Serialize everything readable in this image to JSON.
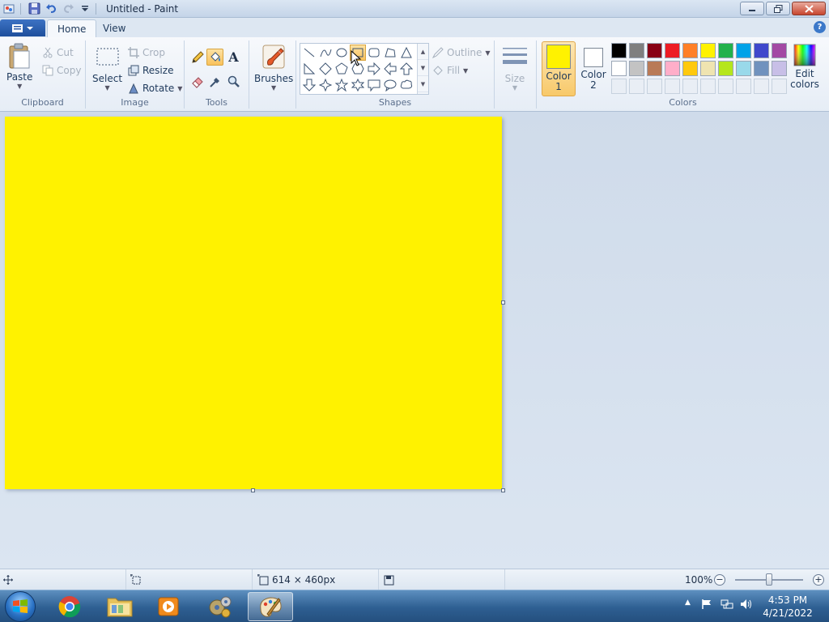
{
  "window": {
    "title": "Untitled - Paint"
  },
  "tabs": [
    {
      "label": "Home",
      "active": true
    },
    {
      "label": "View",
      "active": false
    }
  ],
  "ribbon": {
    "clipboard": {
      "label": "Clipboard",
      "paste": "Paste",
      "cut": "Cut",
      "copy": "Copy"
    },
    "image": {
      "label": "Image",
      "select": "Select",
      "crop": "Crop",
      "resize": "Resize",
      "rotate": "Rotate"
    },
    "tools": {
      "label": "Tools"
    },
    "brushes": {
      "label": "Brushes"
    },
    "shapes": {
      "label": "Shapes",
      "outline": "Outline",
      "fill": "Fill"
    },
    "size": {
      "label": "Size"
    },
    "colors": {
      "label": "Colors",
      "color1_line1": "Color",
      "color1_line2": "1",
      "color2_line1": "Color",
      "color2_line2": "2",
      "edit_line1": "Edit",
      "edit_line2": "colors",
      "color1": "#fff200",
      "color2": "#ffffff",
      "palette_row1": [
        "#000000",
        "#7f7f7f",
        "#880015",
        "#ed1c24",
        "#ff7f27",
        "#fff200",
        "#22b14c",
        "#00a2e8",
        "#3f48cc",
        "#a349a4"
      ],
      "palette_row2": [
        "#ffffff",
        "#c3c3c3",
        "#b97a57",
        "#ffaec9",
        "#ffc90e",
        "#efe4b0",
        "#b5e61d",
        "#99d9ea",
        "#7092be",
        "#c8bfe7"
      ]
    }
  },
  "canvas": {
    "color": "#fff200"
  },
  "status": {
    "dimensions": "614 × 460px",
    "zoom": "100%"
  },
  "taskbar": {
    "time": "4:53 PM",
    "date": "4/21/2022"
  }
}
